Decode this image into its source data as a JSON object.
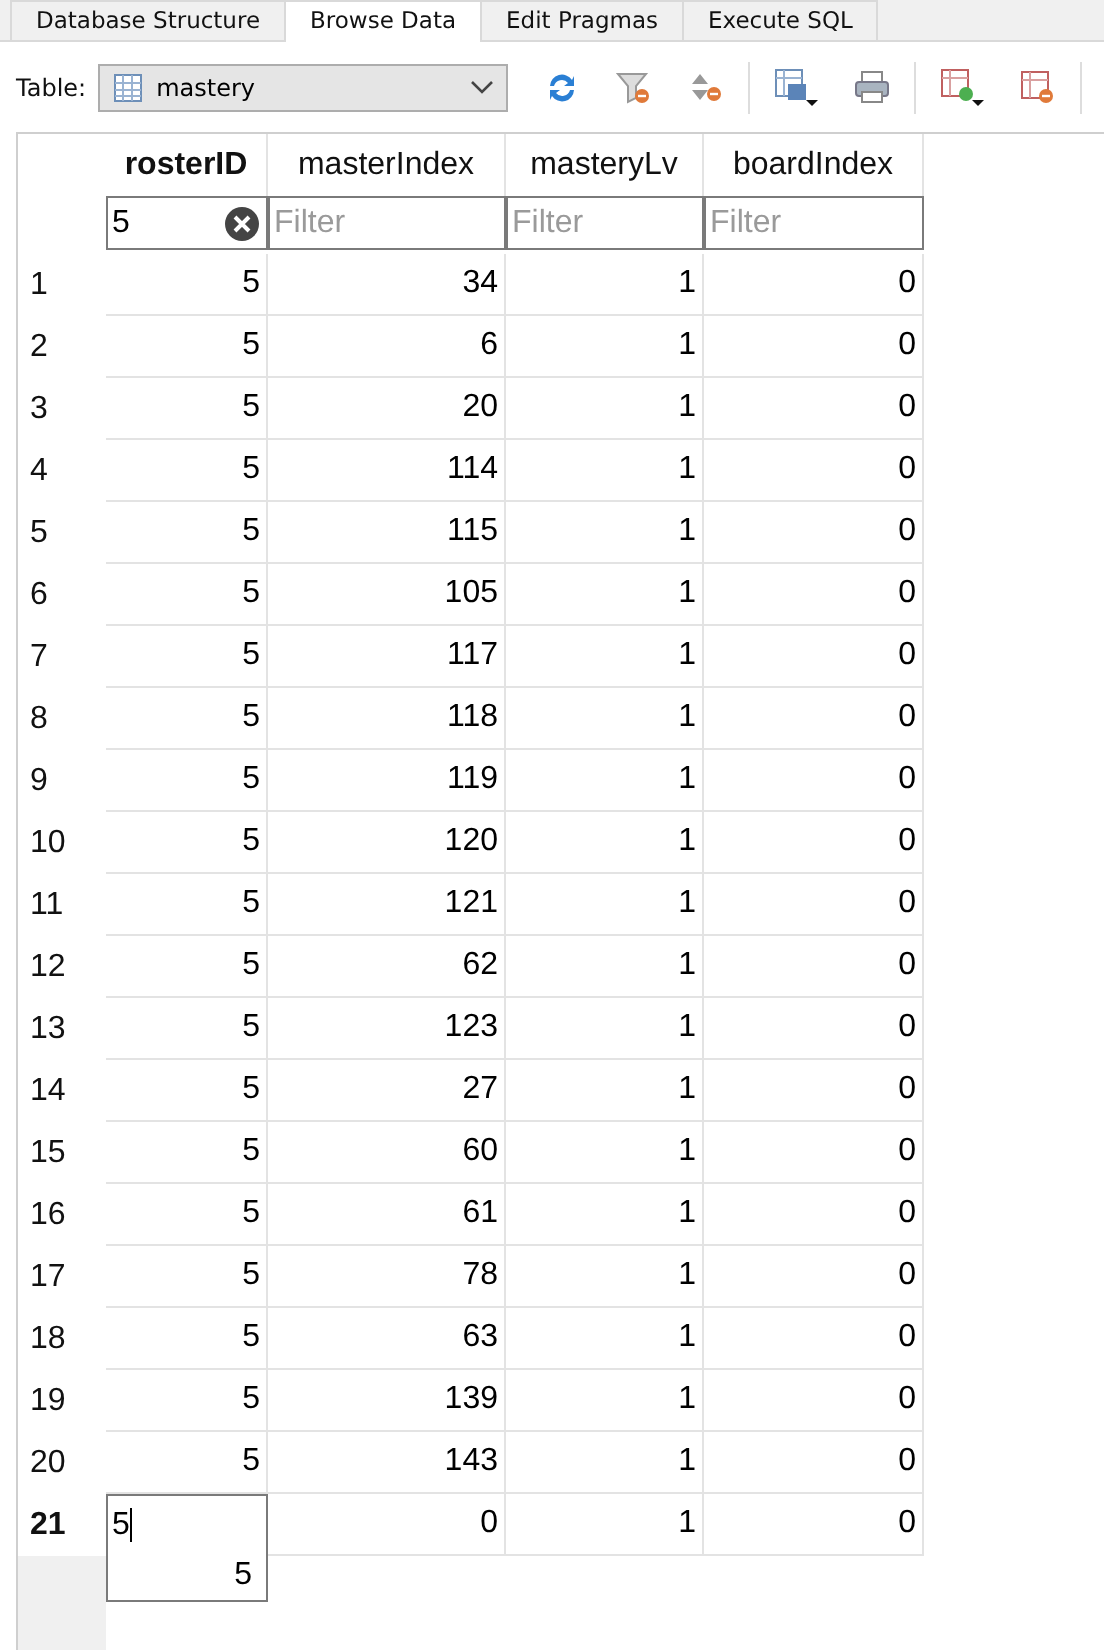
{
  "tabs": [
    {
      "label": "Database Structure",
      "selected": false
    },
    {
      "label": "Browse Data",
      "selected": true
    },
    {
      "label": "Edit Pragmas",
      "selected": false
    },
    {
      "label": "Execute SQL",
      "selected": false
    }
  ],
  "toolbar": {
    "table_label": "Table:",
    "table_value": "mastery"
  },
  "columns": [
    {
      "name": "rosterID",
      "sorted": true
    },
    {
      "name": "masterIndex",
      "sorted": false
    },
    {
      "name": "masteryLv",
      "sorted": false
    },
    {
      "name": "boardIndex",
      "sorted": false
    }
  ],
  "filters": [
    {
      "value": "5"
    },
    {
      "placeholder": "Filter"
    },
    {
      "placeholder": "Filter"
    },
    {
      "placeholder": "Filter"
    }
  ],
  "rows": [
    {
      "number": "1",
      "cells": [
        "5",
        "34",
        "1",
        "0"
      ]
    },
    {
      "number": "2",
      "cells": [
        "5",
        "6",
        "1",
        "0"
      ]
    },
    {
      "number": "3",
      "cells": [
        "5",
        "20",
        "1",
        "0"
      ]
    },
    {
      "number": "4",
      "cells": [
        "5",
        "114",
        "1",
        "0"
      ]
    },
    {
      "number": "5",
      "cells": [
        "5",
        "115",
        "1",
        "0"
      ]
    },
    {
      "number": "6",
      "cells": [
        "5",
        "105",
        "1",
        "0"
      ]
    },
    {
      "number": "7",
      "cells": [
        "5",
        "117",
        "1",
        "0"
      ]
    },
    {
      "number": "8",
      "cells": [
        "5",
        "118",
        "1",
        "0"
      ]
    },
    {
      "number": "9",
      "cells": [
        "5",
        "119",
        "1",
        "0"
      ]
    },
    {
      "number": "10",
      "cells": [
        "5",
        "120",
        "1",
        "0"
      ]
    },
    {
      "number": "11",
      "cells": [
        "5",
        "121",
        "1",
        "0"
      ]
    },
    {
      "number": "12",
      "cells": [
        "5",
        "62",
        "1",
        "0"
      ]
    },
    {
      "number": "13",
      "cells": [
        "5",
        "123",
        "1",
        "0"
      ]
    },
    {
      "number": "14",
      "cells": [
        "5",
        "27",
        "1",
        "0"
      ]
    },
    {
      "number": "15",
      "cells": [
        "5",
        "60",
        "1",
        "0"
      ]
    },
    {
      "number": "16",
      "cells": [
        "5",
        "61",
        "1",
        "0"
      ]
    },
    {
      "number": "17",
      "cells": [
        "5",
        "78",
        "1",
        "0"
      ]
    },
    {
      "number": "18",
      "cells": [
        "5",
        "63",
        "1",
        "0"
      ]
    },
    {
      "number": "19",
      "cells": [
        "5",
        "139",
        "1",
        "0"
      ]
    },
    {
      "number": "20",
      "cells": [
        "5",
        "143",
        "1",
        "0"
      ]
    }
  ],
  "new_row": {
    "number": "21",
    "selected": true,
    "editing_value": "5",
    "cells": [
      "0",
      "1",
      "0"
    ]
  },
  "autocomplete": [
    "5"
  ]
}
